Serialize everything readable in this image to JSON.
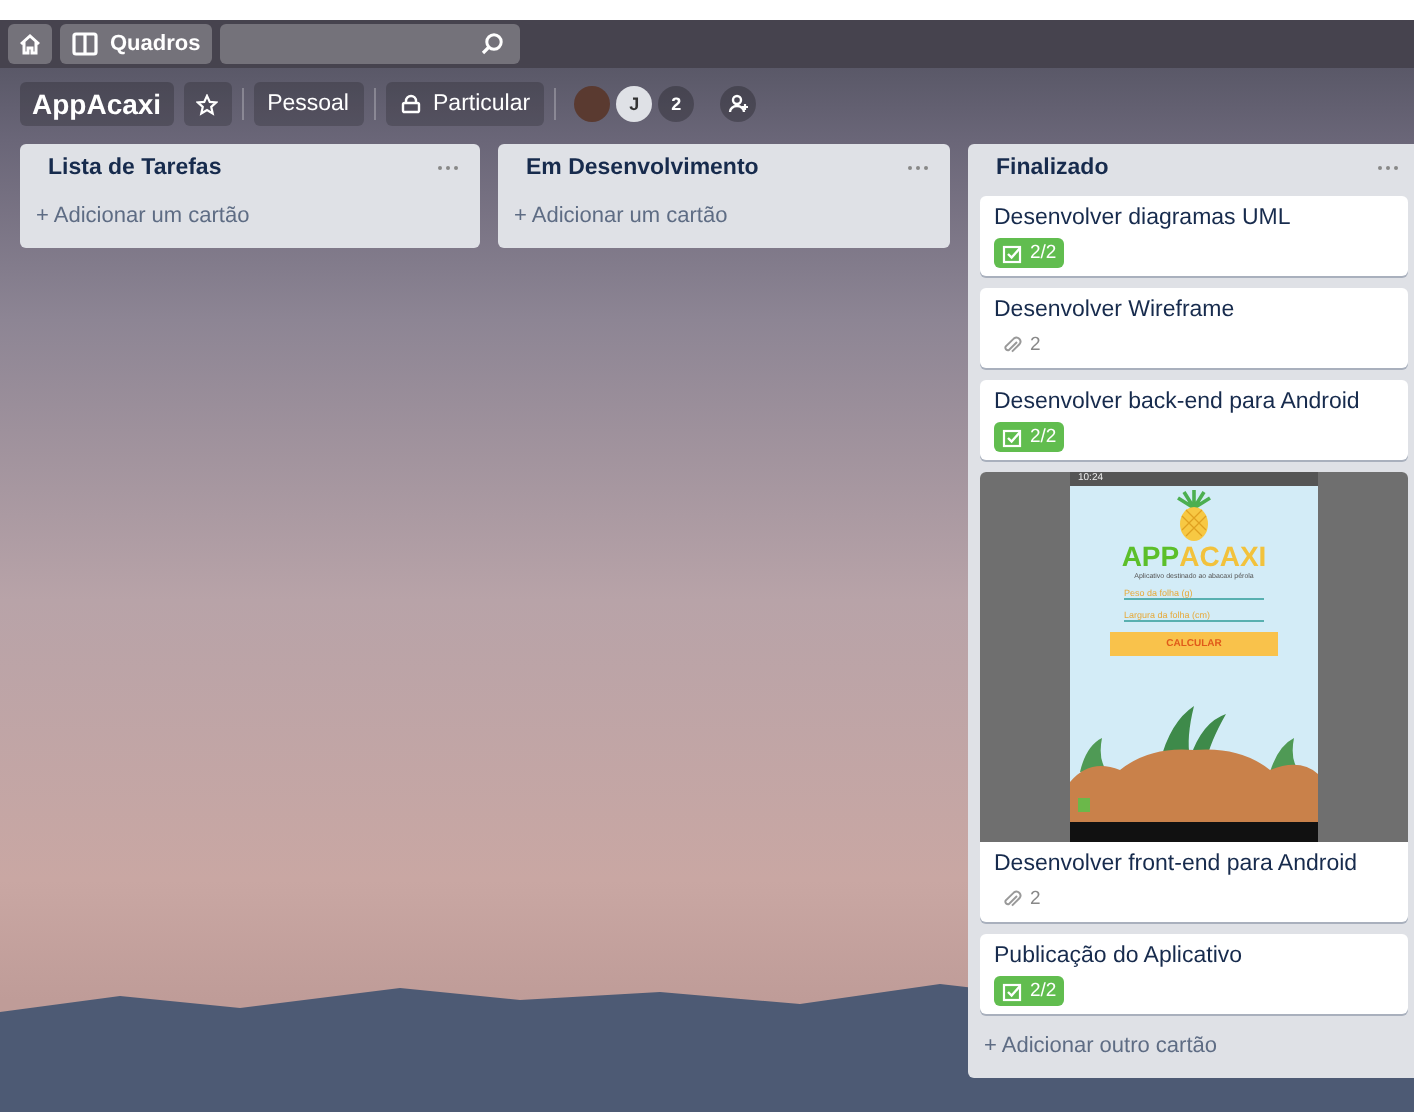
{
  "nav": {
    "boards_label": "Quadros"
  },
  "board": {
    "title": "AppAcaxi",
    "team": "Pessoal",
    "visibility": "Particular",
    "members": [
      {
        "kind": "photo"
      },
      {
        "kind": "initial",
        "label": "J"
      },
      {
        "kind": "count",
        "label": "2"
      }
    ]
  },
  "lists": [
    {
      "title": "Lista de Tarefas",
      "add_label": "+ Adicionar um cartão"
    },
    {
      "title": "Em Desenvolvimento",
      "add_label": "+ Adicionar um cartão"
    },
    {
      "title": "Finalizado",
      "add_label": "+ Adicionar outro cartão",
      "cards": [
        {
          "title": "Desenvolver diagramas UML",
          "badge": {
            "kind": "checklist",
            "label": "2/2"
          }
        },
        {
          "title": "Desenvolver Wireframe",
          "badge": {
            "kind": "attachments",
            "label": "2"
          }
        },
        {
          "title": "Desenvolver back-end para Android",
          "badge": {
            "kind": "checklist",
            "label": "2/2"
          }
        },
        {
          "title": "Desenvolver front-end para Android",
          "badge": {
            "kind": "attachments",
            "label": "2"
          },
          "cover": {
            "time": "10:24",
            "logo_a": "APP",
            "logo_b": "ACAXI",
            "subtitle": "Aplicativo destinado ao abacaxi pérola",
            "fields": [
              "Peso da folha (g)",
              "Largura da folha (cm)"
            ],
            "button": "CALCULAR"
          }
        },
        {
          "title": "Publicação do Aplicativo",
          "badge": {
            "kind": "checklist",
            "label": "2/2"
          }
        }
      ]
    }
  ]
}
